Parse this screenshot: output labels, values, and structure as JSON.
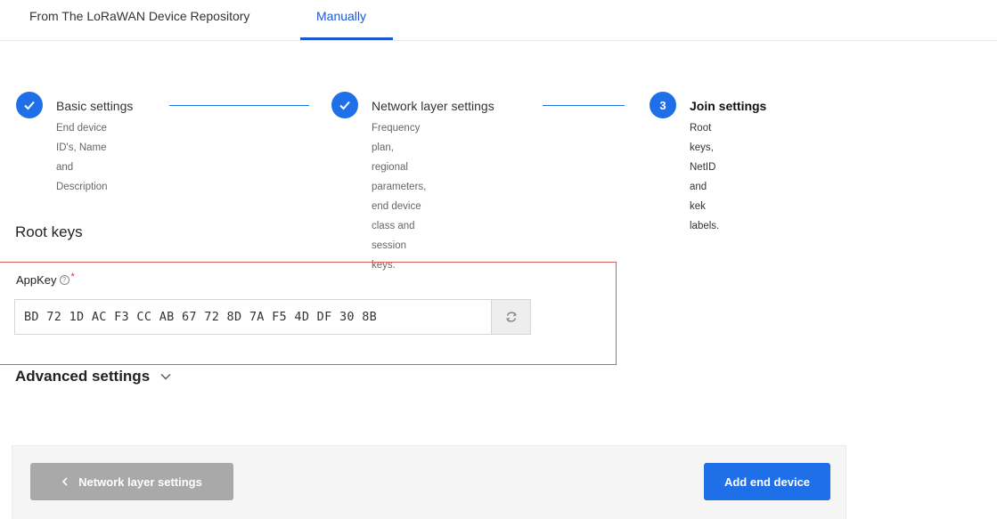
{
  "tabs": [
    {
      "label": "From The LoRaWAN Device Repository",
      "active": false
    },
    {
      "label": "Manually",
      "active": true
    }
  ],
  "steps": [
    {
      "number": "",
      "state": "done",
      "icon": "checkmark-icon",
      "title": "Basic settings",
      "desc": [
        "End device ID's, Name and",
        "Description"
      ]
    },
    {
      "number": "",
      "state": "done",
      "icon": "checkmark-icon",
      "title": "Network layer settings",
      "desc": [
        "Frequency plan, regional",
        "parameters, end device",
        "class and session keys."
      ]
    },
    {
      "number": "3",
      "state": "current",
      "title": "Join settings",
      "desc": [
        "Root keys, NetID and kek",
        "labels."
      ]
    }
  ],
  "root_keys": {
    "title": "Root keys",
    "appkey_label": "AppKey",
    "required_mark": "*",
    "appkey_value": "BD 72 1D AC F3 CC AB 67 72 8D 7A F5 4D DF 30 8B",
    "regenerate_icon": "refresh-icon"
  },
  "advanced": {
    "label": "Advanced settings",
    "icon": "chevron-down-icon"
  },
  "footer": {
    "back_label": "Network layer settings",
    "submit_label": "Add end device"
  },
  "colors": {
    "accent": "#1e6fe8",
    "highlight": "#e05a5a",
    "disabled": "#a9a9a9"
  }
}
